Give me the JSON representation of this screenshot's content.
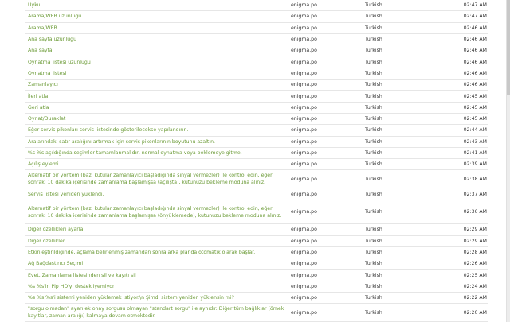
{
  "rows": [
    {
      "message": "Uyku",
      "file": "enigma.po",
      "language": "Turkish",
      "time": "02:47 AM"
    },
    {
      "message": "Arama/WEB uzunluğu",
      "file": "enigma.po",
      "language": "Turkish",
      "time": "02:47 AM"
    },
    {
      "message": "Arama/WEB",
      "file": "enigma.po",
      "language": "Turkish",
      "time": "02:46 AM"
    },
    {
      "message": "Ana sayfa uzunluğu",
      "file": "enigma.po",
      "language": "Turkish",
      "time": "02:46 AM"
    },
    {
      "message": "Ana sayfa",
      "file": "enigma.po",
      "language": "Turkish",
      "time": "02:46 AM"
    },
    {
      "message": "Oynatma listesi uzunluğu",
      "file": "enigma.po",
      "language": "Turkish",
      "time": "02:46 AM"
    },
    {
      "message": "Oynatma listesi",
      "file": "enigma.po",
      "language": "Turkish",
      "time": "02:46 AM"
    },
    {
      "message": "Zamanlayıcı",
      "file": "enigma.po",
      "language": "Turkish",
      "time": "02:46 AM"
    },
    {
      "message": "İleri atla",
      "file": "enigma.po",
      "language": "Turkish",
      "time": "02:45 AM"
    },
    {
      "message": "Geri atla",
      "file": "enigma.po",
      "language": "Turkish",
      "time": "02:45 AM"
    },
    {
      "message": "Oynat/Duraklat",
      "file": "enigma.po",
      "language": "Turkish",
      "time": "02:45 AM"
    },
    {
      "message": "Eğer servis pikonları servis listesinde gösterilecekse yapılandırın.",
      "file": "enigma.po",
      "language": "Turkish",
      "time": "02:44 AM"
    },
    {
      "message": "Aralarındaki satır aralığını artırmak için servis pikonlarının boyutunu azaltın.",
      "file": "enigma.po",
      "language": "Turkish",
      "time": "02:43 AM"
    },
    {
      "message": "%s %s açıldığında seçimler tamamlanmalıdır, normal oynatma veya beklemeye gitme.",
      "file": "enigma.po",
      "language": "Turkish",
      "time": "02:41 AM"
    },
    {
      "message": "Açılış eylemi",
      "file": "enigma.po",
      "language": "Turkish",
      "time": "02:39 AM"
    },
    {
      "message": "Alternatif bir yöntem (bazı kutular zamanlayıcı başladığında sinyal vermezler) ile kontrol edin, eğer sonraki 10 dakika içerisinde zamanlama başlamışsa (açılışta), kutunuzu bekleme moduna alınız.",
      "file": "enigma.po",
      "language": "Turkish",
      "time": "02:38 AM"
    },
    {
      "message": "Servis listesi yeniden yüklendi.",
      "file": "enigma.po",
      "language": "Turkish",
      "time": "02:37 AM"
    },
    {
      "message": "Alternatif bir yöntem (bazı kutular zamanlayıcı başladığında sinyal vermezler) ile kontrol edin, eğer sonraki 10 dakika içerisinde zamanlama başlamışsa (önyüklemede), kutunuzu bekleme moduna alınız.",
      "file": "enigma.po",
      "language": "Turkish",
      "time": "02:36 AM"
    },
    {
      "message": "Diğer özellikleri ayarla",
      "file": "enigma.po",
      "language": "Turkish",
      "time": "02:29 AM"
    },
    {
      "message": "Diğer özellikler",
      "file": "enigma.po",
      "language": "Turkish",
      "time": "02:29 AM"
    },
    {
      "message": "Etkinleştirildiğinde, açlama belirlenmiş zamandan sonra arka planda otomatik olarak başlar.",
      "file": "enigma.po",
      "language": "Turkish",
      "time": "02:28 AM"
    },
    {
      "message": "Ağ Bağdaştırıcı Seçimi",
      "file": "enigma.po",
      "language": "Turkish",
      "time": "02:26 AM"
    },
    {
      "message": "Evet, Zamanlama listesinden sil ve kayıtı sil",
      "file": "enigma.po",
      "language": "Turkish",
      "time": "02:25 AM"
    },
    {
      "message": "%s %s'in Pip HD'yi destekliyemiyor",
      "file": "enigma.po",
      "language": "Turkish",
      "time": "02:24 AM"
    },
    {
      "message": "%s %s %s'i sistemi yeniden yüklemek istiyor.\\n Şimdi sistem yeniden yüklensin mi?",
      "file": "enigma.po",
      "language": "Turkish",
      "time": "02:22 AM"
    },
    {
      "message": "\"sorgu olmadan\" ayarı ek onay sorgusu olmayan \"standart sorgu\" ile aynıdır. Diğer tüm bağlıklar (örnek kayıtlar, zaman aralığı) kalmaya devam etmektedir.",
      "file": "enigma.po",
      "language": "Turkish",
      "time": "02:20 AM"
    }
  ]
}
